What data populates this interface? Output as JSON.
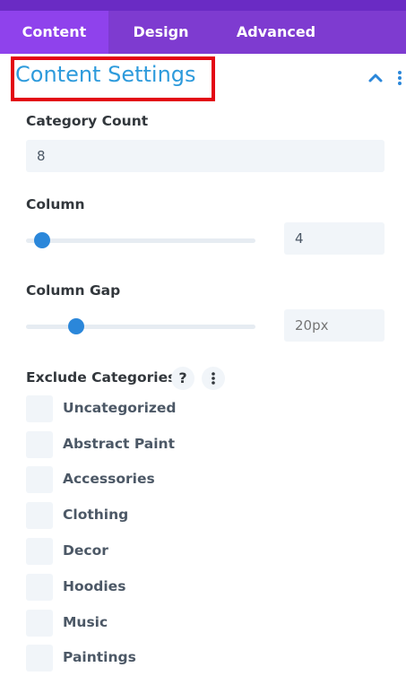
{
  "tabs": [
    {
      "label": "Content",
      "active": true
    },
    {
      "label": "Design",
      "active": false
    },
    {
      "label": "Advanced",
      "active": false
    }
  ],
  "section": {
    "title": "Content Settings",
    "collapse_icon": "chevron-up-icon",
    "more_icon": "vertical-dots-icon",
    "highlight_color": "#e30613"
  },
  "fields": {
    "category_count": {
      "label": "Category Count",
      "value": "8"
    },
    "column": {
      "label": "Column",
      "value": "4",
      "slider_fraction": 0.07
    },
    "column_gap": {
      "label": "Column Gap",
      "placeholder": "20px",
      "slider_fraction": 0.22
    },
    "exclude_categories": {
      "label": "Exclude Categories",
      "help_label": "?",
      "options": [
        {
          "label": "Uncategorized",
          "checked": false
        },
        {
          "label": "Abstract Paint",
          "checked": false
        },
        {
          "label": "Accessories",
          "checked": false
        },
        {
          "label": "Clothing",
          "checked": false
        },
        {
          "label": "Decor",
          "checked": false
        },
        {
          "label": "Hoodies",
          "checked": false
        },
        {
          "label": "Music",
          "checked": false
        },
        {
          "label": "Paintings",
          "checked": false
        }
      ]
    }
  },
  "colors": {
    "tab_bar": "#7e3bd0",
    "tab_active": "#8f42ec",
    "accent_blue": "#2b87da",
    "title_blue": "#2e9bdc"
  }
}
